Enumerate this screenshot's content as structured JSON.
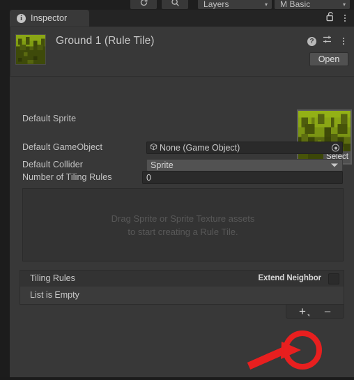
{
  "toolbar": {
    "rotate_icon": "rotate-icon",
    "search_icon": "search-icon",
    "layers_label": "Layers",
    "layout_label": "M Basic",
    "dropdown_arrow": "▾"
  },
  "tab": {
    "icon": "info-icon",
    "icon_glyph": "i",
    "label": "Inspector",
    "lock_icon": "lock-open-icon",
    "menu_icon": "kebab-menu-icon"
  },
  "object_header": {
    "thumbnail": "rule-tile-thumbnail",
    "title": "Ground 1 (Rule Tile)",
    "help_icon": "help-icon",
    "help_glyph": "?",
    "preset_icon": "preset-settings-icon",
    "menu_icon": "kebab-menu-icon",
    "open_label": "Open"
  },
  "fields": {
    "default_sprite": {
      "label": "Default Sprite",
      "preview": "sprite-preview",
      "select_label": "Select"
    },
    "default_gameobject": {
      "label": "Default GameObject",
      "value": "None (Game Object)",
      "object_icon": "cube-icon",
      "picker_icon": "object-picker-icon"
    },
    "default_collider": {
      "label": "Default Collider",
      "value": "Sprite",
      "dropdown_arrow": "▾"
    },
    "number_of_tiling_rules": {
      "label": "Number of Tiling Rules",
      "value": "0"
    }
  },
  "drag_area": {
    "line1": "Drag Sprite or Sprite Texture assets",
    "line2": "to start creating a Rule Tile."
  },
  "tiling_rules": {
    "header_label": "Tiling Rules",
    "extend_neighbor_label": "Extend Neighbor",
    "extend_neighbor_checked": false,
    "empty_label": "List is Empty",
    "add_button": "+",
    "remove_button": "–"
  },
  "annotation": {
    "highlight_color": "#e81f1f",
    "circle_target": "add-rule-button",
    "arrow": "pointer-arrow"
  },
  "colors": {
    "panel_bg": "#383838",
    "window_bg": "#1c1c1c",
    "tab_bg": "#393939",
    "field_bg": "#2a2a2a",
    "enum_bg": "#525252",
    "text": "#c4c4c4",
    "accent_red": "#e81f1f"
  }
}
